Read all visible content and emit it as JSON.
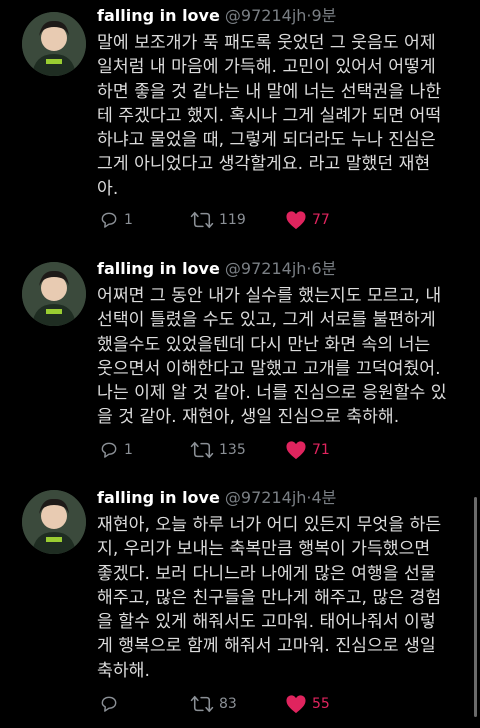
{
  "tweets": [
    {
      "name": "falling in love",
      "handle": "@97214jh",
      "time": "9분",
      "lines": [
        "말에 보조개가 푹 패도록 웃었던 그 웃음도 어제",
        "일처럼 내 마음에 가득해. 고민이 있어서 어떻게",
        "하면 좋을 것 같냐는 내 말에 너는 선택권을 나한",
        "테 주겠다고 했지. 혹시나 그게 실례가 되면 어떡",
        "하냐고 물었을 때, 그렇게 되더라도 누나 진심은",
        "그게 아니었다고 생각할게요. 라고 말했던 재현",
        "아."
      ],
      "replies": "1",
      "retweets": "119",
      "likes": "77"
    },
    {
      "name": "falling in love",
      "handle": "@97214jh",
      "time": "6분",
      "lines": [
        "어쩌면 그 동안 내가 실수를 했는지도 모르고, 내",
        "선택이 틀렸을 수도 있고, 그게 서로를 불편하게",
        "했을수도 있었을텐데 다시 만난 화면 속의 너는",
        "웃으면서 이해한다고 말했고 고개를 끄덕여줬어.",
        "나는 이제 알 것 같아. 너를 진심으로 응원할수 있",
        "을 것 같아. 재현아, 생일 진심으로 축하해."
      ],
      "replies": "1",
      "retweets": "135",
      "likes": "71"
    },
    {
      "name": "falling in love",
      "handle": "@97214jh",
      "time": "4분",
      "lines": [
        "재현아, 오늘 하루 너가 어디 있든지 무엇을 하든",
        "지, 우리가 보내는 축복만큼 행복이 가득했으면",
        "좋겠다. 보러 다니느라 나에게 많은 여행을 선물",
        "해주고, 많은 친구들을 만나게 해주고, 많은 경험",
        "을 할수 있게 해줘서도 고마워. 태어나줘서 이렇",
        "게 행복으로 함께 해줘서 고마워. 진심으로 생일",
        "축하해."
      ],
      "replies": "",
      "retweets": "83",
      "likes": "55"
    }
  ],
  "colors": {
    "like": "#e0245e",
    "muted": "#8b9096",
    "background": "#000000"
  },
  "icons": [
    "reply-icon",
    "retweet-icon",
    "heart-icon",
    "avatar-photo"
  ]
}
